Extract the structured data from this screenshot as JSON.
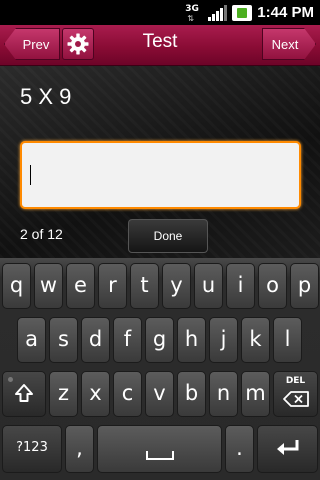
{
  "status_bar": {
    "network": "3G",
    "time": "1:44 PM"
  },
  "title_bar": {
    "prev_label": "Prev",
    "title": "Test",
    "next_label": "Next"
  },
  "content": {
    "question": "5 X 9",
    "answer_value": "",
    "progress": "2 of 12",
    "done_label": "Done"
  },
  "keyboard": {
    "row1": [
      "q",
      "w",
      "e",
      "r",
      "t",
      "y",
      "u",
      "i",
      "o",
      "p"
    ],
    "row2": [
      "a",
      "s",
      "d",
      "f",
      "g",
      "h",
      "j",
      "k",
      "l"
    ],
    "row3": [
      "z",
      "x",
      "c",
      "v",
      "b",
      "n",
      "m"
    ],
    "del_label": "DEL",
    "mode_label": "?123",
    "comma": ",",
    "period": "."
  },
  "colors": {
    "accent": "#8a0c35",
    "focus_border": "#ff8a00"
  }
}
